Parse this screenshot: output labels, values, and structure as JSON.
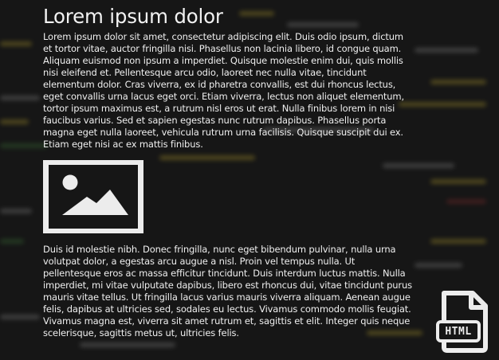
{
  "page": {
    "title": "Lorem ipsum dolor",
    "paragraphs": [
      "Lorem ipsum dolor sit amet, consectetur adipiscing elit. Duis odio ipsum, dictum et tortor vitae, auctor fringilla nisi. Phasellus non lacinia libero, id congue quam. Aliquam euismod non ipsum a imperdiet. Quisque molestie enim dui, quis mollis nisi eleifend et. Pellentesque arcu odio, laoreet nec nulla vitae, tincidunt elementum dolor. Cras viverra, ex id pharetra convallis, est dui rhoncus lectus, eget convallis urna lacus eget orci. Etiam viverra, lectus non aliquet elementum, tortor ipsum maximus est, a rutrum nisl eros ut erat. Nulla finibus lorem in nisi faucibus varius. Sed et sapien egestas nunc rutrum dapibus. Phasellus porta magna eget nulla laoreet, vehicula rutrum urna facilisis. Quisque suscipit dui ex. Etiam eget nisi ac ex mattis finibus.",
      "Duis id molestie nibh. Donec fringilla, nunc eget bibendum pulvinar, nulla urna volutpat dolor, a egestas arcu augue a nisl. Proin vel tempus nulla. Ut pellentesque eros ac massa efficitur tincidunt. Duis interdum luctus mattis. Nulla imperdiet, mi vitae vulputate dapibus, libero est rhoncus dui, vitae tincidunt purus mauris vitae tellus. Ut fringilla lacus varius mauris viverra aliquam. Aenean augue felis, dapibus at ultricies sed, sodales eu lectus. Vivamus commodo mollis feugiat. Vivamus magna est, viverra sit amet rutrum et, sagittis et elit. Integer quis neque scelerisque, sagittis metus ut, ultricies felis."
    ]
  },
  "image": {
    "icon": "image-placeholder-icon"
  },
  "badge": {
    "label": "HTML",
    "icon": "html-file-icon"
  },
  "colors": {
    "background": "#161616",
    "text": "#efefef",
    "icon": "#ececec",
    "code_yellow": "#b8a22e",
    "code_green": "#3f7a3a",
    "code_red": "#8a2f2f"
  }
}
